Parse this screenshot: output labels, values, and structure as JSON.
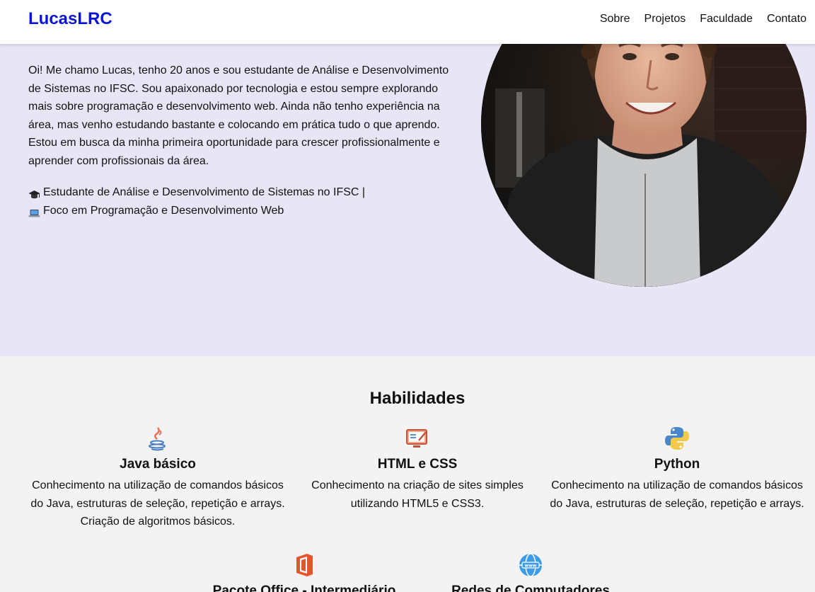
{
  "header": {
    "logo": "LucasLRC",
    "nav": [
      "Sobre",
      "Projetos",
      "Faculdade",
      "Contato"
    ]
  },
  "hero": {
    "intro": "Oi! Me chamo Lucas, tenho 20 anos e sou estudante de Análise e Desenvolvimento de Sistemas no IFSC. Sou apaixonado por tecnologia e estou sempre explorando mais sobre programação e desenvolvimento web. Ainda não tenho experiência na área, mas venho estudando bastante e colocando em prática tudo o que aprendo. Estou em busca da minha primeira oportunidade para crescer profissionalmente e aprender com profissionais da área.",
    "tag_student": "Estudante de Análise e Desenvolvimento de Sistemas no IFSC |",
    "tag_focus": "Foco em Programação e Desenvolvimento Web",
    "photo_icon": "profile-photo"
  },
  "skills": {
    "title": "Habilidades",
    "items": [
      {
        "title": "Java básico",
        "desc": "Conhecimento na utilização de comandos básicos do Java, estruturas de seleção, repetição e arrays. Criação de algoritmos básicos.",
        "icon": "java-icon"
      },
      {
        "title": "HTML e CSS",
        "desc": "Conhecimento na criação de sites simples utilizando HTML5 e CSS3.",
        "icon": "html-css-icon"
      },
      {
        "title": "Python",
        "desc": "Conhecimento na utilização de comandos básicos do Java, estruturas de seleção, repetição e arrays.",
        "icon": "python-icon"
      },
      {
        "title": "Pacote Office - Intermediário",
        "desc": "",
        "icon": "office-icon"
      },
      {
        "title": "Redes de Computadores",
        "desc": "",
        "icon": "network-icon"
      }
    ]
  }
}
